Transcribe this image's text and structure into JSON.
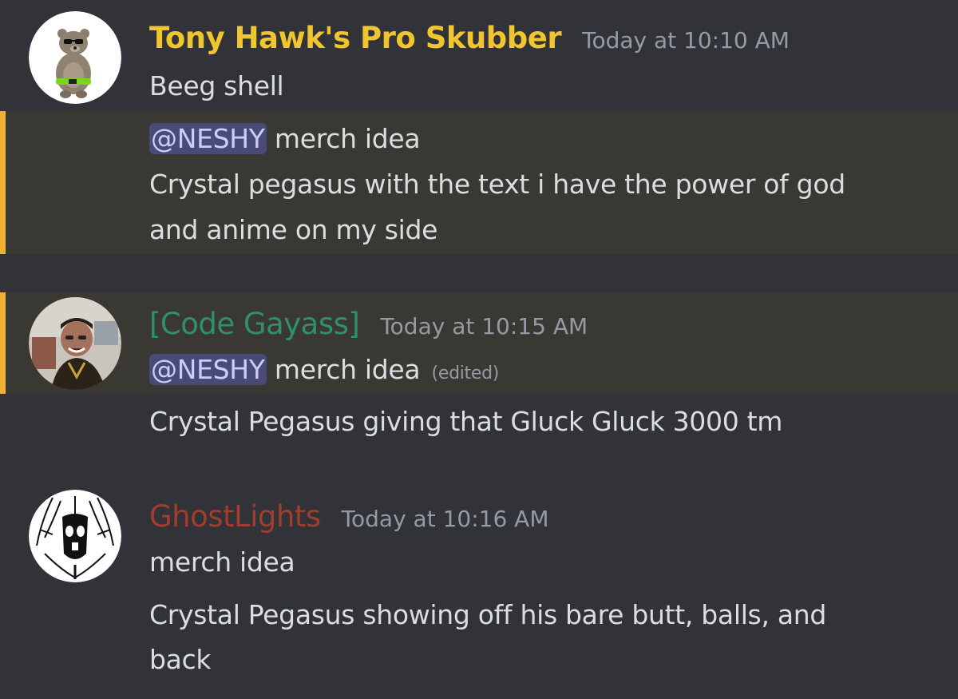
{
  "messages": [
    {
      "username": "Tony Hawk's Pro Skubber",
      "username_color": "#f0c52e",
      "timestamp": "Today at 10:10 AM",
      "avatar_icon": "bear-sunglasses-avatar",
      "lines": [
        "Beeg shell"
      ]
    },
    {
      "mention": "@NESHY",
      "text": "merch idea",
      "lines": [
        "Crystal pegasus with the text i have the power of god",
        "and anime on my side"
      ]
    },
    {
      "username": "[Code Gayass]",
      "username_color": "#2f8f6e",
      "timestamp": "Today at 10:15 AM",
      "avatar_icon": "person-photo-avatar",
      "mention": "@NESHY",
      "text": "merch idea",
      "edited": "(edited)"
    },
    {
      "lines": [
        "Crystal Pegasus giving that Gluck Gluck 3000 tm"
      ]
    },
    {
      "username": "GhostLights",
      "username_color": "#a13d2d",
      "timestamp": "Today at 10:16 AM",
      "avatar_icon": "tribal-mask-avatar",
      "lines": [
        "merch idea",
        "Crystal Pegasus showing off his bare butt, balls, and",
        "back"
      ]
    }
  ],
  "colors": {
    "background": "#313338",
    "highlight_bg": "#3a3833",
    "highlight_bar": "#f0b232",
    "mention_bg": "#4a4a78",
    "mention_text": "#c9cdfb",
    "text": "#dbdee1",
    "timestamp": "#949ba4"
  }
}
